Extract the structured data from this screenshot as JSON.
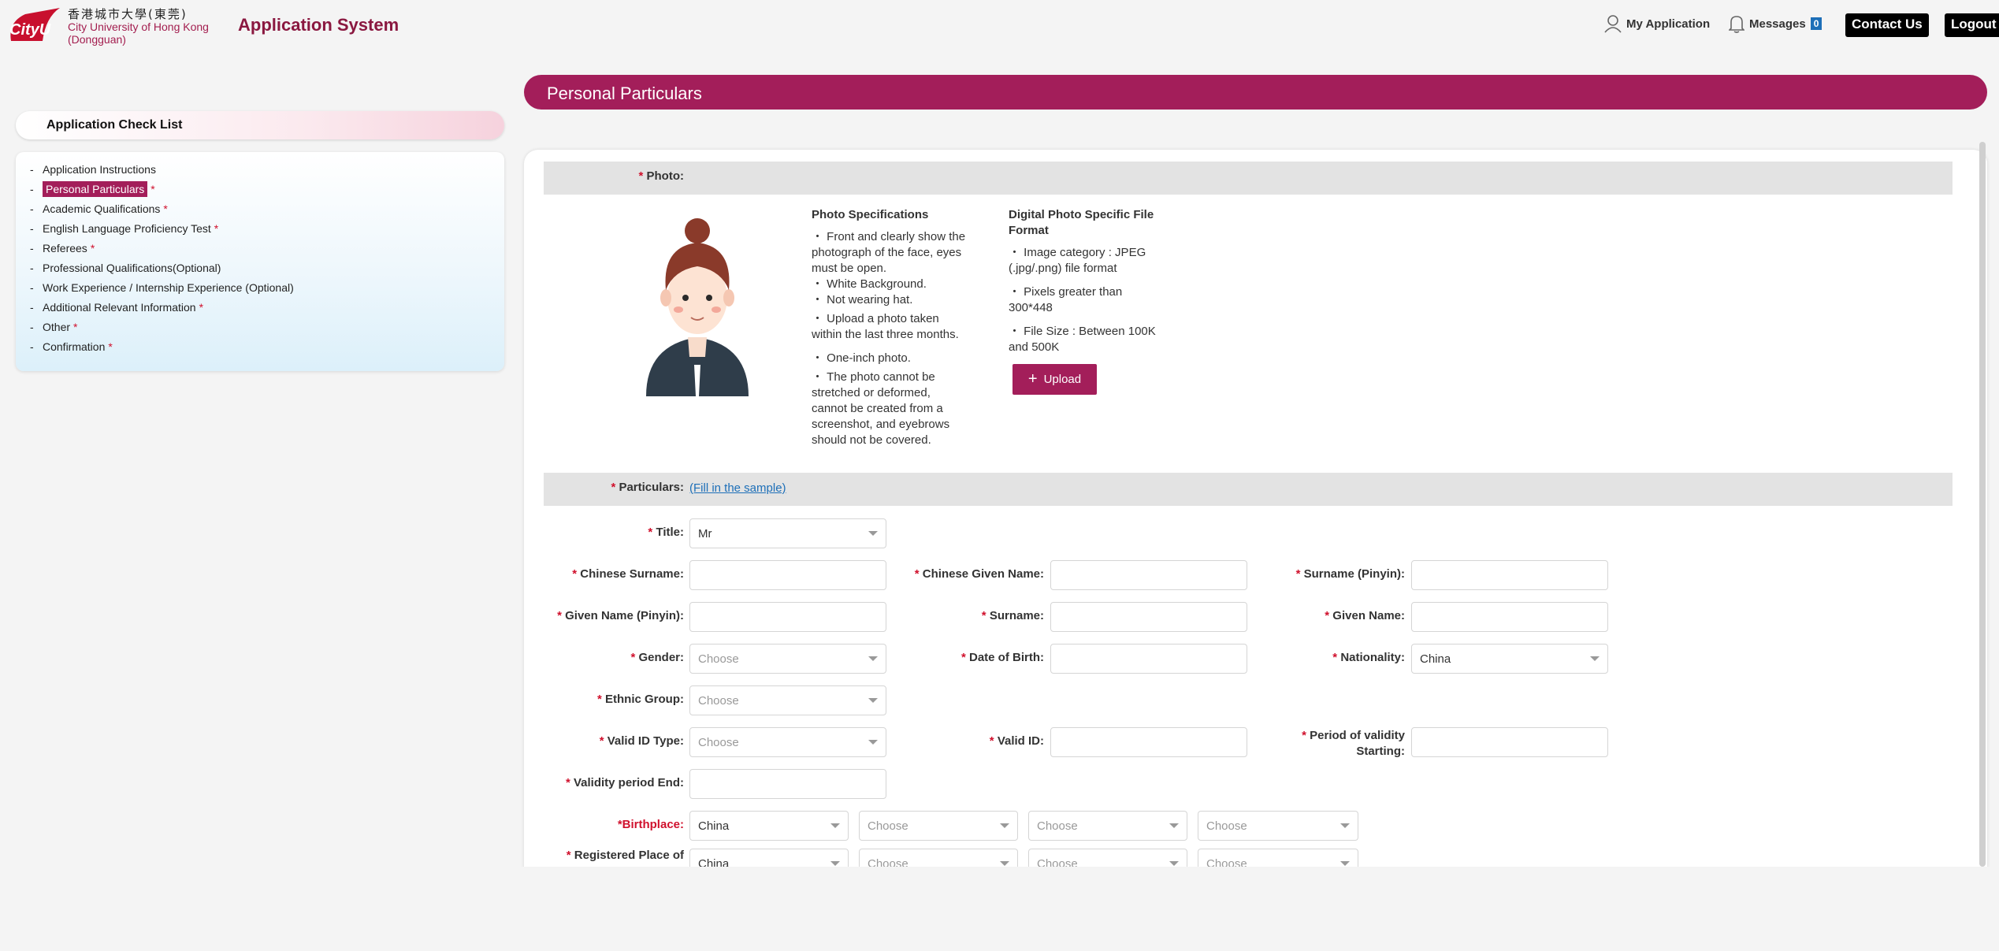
{
  "header": {
    "logo_text": "CityU",
    "school_cn": "香港城市大學(東莞)",
    "school_en1": "City University of Hong Kong",
    "school_en2": "(Dongguan)",
    "app_title": "Application System",
    "my_application": "My Application",
    "messages": "Messages",
    "message_count": "0",
    "contact_us": "Contact Us",
    "logout": "Logout"
  },
  "sidebar": {
    "title": "Application Check List",
    "items": [
      {
        "label": "Application Instructions",
        "required": ""
      },
      {
        "label": "Personal Particulars",
        "required": "*"
      },
      {
        "label": "Academic Qualifications",
        "required": "*"
      },
      {
        "label": "English Language Proficiency Test",
        "required": "*"
      },
      {
        "label": "Referees",
        "required": "*"
      },
      {
        "label": "Professional Qualifications(Optional)",
        "required": ""
      },
      {
        "label": "Work Experience / Internship Experience (Optional)",
        "required": ""
      },
      {
        "label": "Additional Relevant Information",
        "required": "*"
      },
      {
        "label": "Other",
        "required": "*"
      },
      {
        "label": "Confirmation",
        "required": "*"
      }
    ]
  },
  "section": {
    "title": "Personal Particulars",
    "photo_label": "Photo:",
    "particulars_label": "Particulars:",
    "fill_sample": "(Fill in the sample)",
    "upload": "Upload"
  },
  "photo_spec": {
    "title": "Photo Specifications",
    "items": [
      "・ Front and clearly show the photograph of the face, eyes must be open.",
      "・ White Background.",
      "・ Not wearing hat.",
      "・ Upload a photo taken within the last three months.",
      "・ One-inch photo.",
      "・ The photo cannot be stretched or deformed, cannot be created from a screenshot, and eyebrows should not be covered."
    ]
  },
  "file_spec": {
    "title": "Digital Photo Specific File Format",
    "items": [
      "・ Image category : JPEG (.jpg/.png) file format",
      "・ Pixels greater than 300*448",
      "・ File Size : Between 100K and 500K"
    ]
  },
  "form": {
    "title_label": "Title:",
    "title_value": "Mr",
    "chinese_surname": "Chinese Surname:",
    "chinese_given_name": "Chinese Given Name:",
    "surname_pinyin": "Surname (Pinyin):",
    "given_name_pinyin": "Given Name (Pinyin):",
    "surname": "Surname:",
    "given_name": "Given Name:",
    "gender": "Gender:",
    "date_of_birth": "Date of Birth:",
    "nationality": "Nationality:",
    "nationality_value": "China",
    "ethnic_group": "Ethnic Group:",
    "valid_id_type": "Valid ID Type:",
    "valid_id": "Valid ID:",
    "period_validity_1": "Period of validity",
    "period_validity_2": "Starting:",
    "validity_end": "Validity period End:",
    "birthplace": "*Birthplace:",
    "birthplace_value": "China",
    "registered_place": "Registered Place of",
    "registered_value": "China",
    "choose": "Choose"
  },
  "colors": {
    "brand": "#a31e5a",
    "required": "#d0102c",
    "link": "#1d6fb8"
  }
}
